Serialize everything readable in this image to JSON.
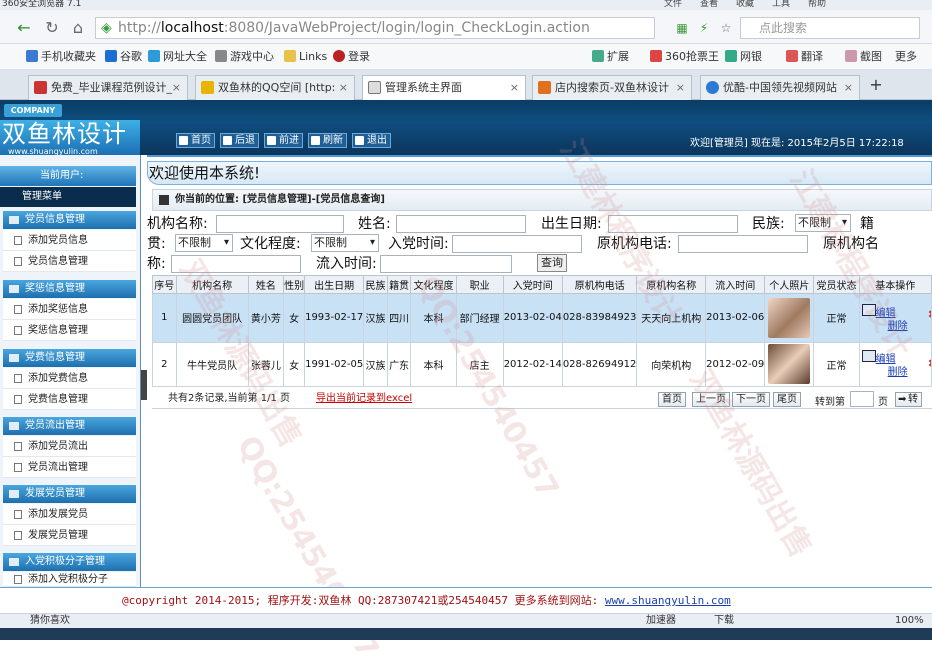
{
  "browser": {
    "title": "360安全浏览器 7.1",
    "menus": [
      "文件",
      "查看",
      "收藏",
      "工具",
      "帮助"
    ],
    "url_host": "localhost",
    "url_rest": ":8080/JavaWebProject/login/login_CheckLogin.action",
    "search_placeholder": "点此搜索",
    "favorites": [
      "手机收藏夹",
      "谷歌",
      "网址大全",
      "游戏中心",
      "Links",
      "登录",
      "扩展",
      "360抢票王",
      "网银",
      "翻译",
      "截图",
      "更多"
    ],
    "tabs": [
      "免费_毕业课程范例设计_",
      "双鱼林的QQ空间 [http:",
      "管理系统主界面",
      "店内搜索页-双鱼林设计",
      "优酷-中国领先视频网站"
    ]
  },
  "header": {
    "company": "COMPANY",
    "logo": "双鱼林设计",
    "logo_url": "www.shuangyulin.com",
    "nav": [
      "首页",
      "后退",
      "前进",
      "刷新",
      "退出"
    ],
    "welcome": "欢迎[管理员]  现在是: 2015年2月5日 17:22:18"
  },
  "sidebar": {
    "user": "当前用户: ",
    "menu_title": "管理菜单",
    "sections": [
      {
        "title": "党员信息管理",
        "items": [
          "添加党员信息",
          "党员信息管理"
        ]
      },
      {
        "title": "奖惩信息管理",
        "items": [
          "添加奖惩信息",
          "奖惩信息管理"
        ]
      },
      {
        "title": "党费信息管理",
        "items": [
          "添加党费信息",
          "党费信息管理"
        ]
      },
      {
        "title": "党员流出管理",
        "items": [
          "添加党员流出",
          "党员流出管理"
        ]
      },
      {
        "title": "发展党员管理",
        "items": [
          "添加发展党员",
          "发展党员管理"
        ]
      },
      {
        "title": "入党积极分子管理",
        "items": [
          "添加入党积极分子"
        ]
      }
    ]
  },
  "main": {
    "welcome": "欢迎使用本系统!",
    "position": "你当前的位置: [党员信息管理]-[党员信息查询]",
    "form": {
      "org_name": "机构名称:",
      "name": "姓名:",
      "birth": "出生日期:",
      "nation": "民族:",
      "nation_value": "不限制",
      "native": "籍",
      "native2": "贯:",
      "native_value": "不限制",
      "edu": "文化程度:",
      "edu_value": "不限制",
      "join_time": "入党时间:",
      "orig_phone": "原机构电话:",
      "orig_name": "原机构名",
      "orig_name2": "称:",
      "flow_in": "流入时间:",
      "query": "查询"
    },
    "table": {
      "headers": [
        "序号",
        "机构名称",
        "姓名",
        "性别",
        "出生日期",
        "民族",
        "籍贯",
        "文化程度",
        "职业",
        "入党时间",
        "原机构电话",
        "原机构名称",
        "流入时间",
        "个人照片",
        "党员状态",
        "基本操作"
      ],
      "rows": [
        [
          "1",
          "圆圆党员团队",
          "黄小芳",
          "女",
          "1993-02-17",
          "汉族",
          "四川",
          "本科",
          "部门经理",
          "2013-02-04",
          "028-83984923",
          "天天向上机构",
          "2013-02-06",
          "",
          "正常"
        ],
        [
          "2",
          "牛牛党员队",
          "张蓉儿",
          "女",
          "1991-02-05",
          "汉族",
          "广东",
          "本科",
          "店主",
          "2012-02-14",
          "028-82694912",
          "向荣机构",
          "2012-02-09",
          "",
          "正常"
        ]
      ],
      "edit": "编辑",
      "delete": "删除"
    },
    "pager": {
      "info": "共有2条记录,当前第 1/1 页",
      "export": "导出当前记录到excel",
      "first": "首页",
      "prev": "上一页",
      "next": "下一页",
      "last": "尾页",
      "goto": "转到第",
      "page": "页",
      "go": "转"
    }
  },
  "footer": {
    "text": "@copyright 2014-2015; 程序开发:双鱼林  QQ:287307421或254540457  更多系统到网站: ",
    "link": "www.shuangyulin.com"
  },
  "status": {
    "left": "猜你喜欢",
    "accel": "加速器",
    "download": "下载",
    "zoom": "100%"
  },
  "watermarks": [
    "双鱼林源码出售",
    "QQ:254540457",
    "江建林程序设计",
    "双鱼林源码出售",
    "QQ:254540457",
    "江建林程序设计"
  ]
}
